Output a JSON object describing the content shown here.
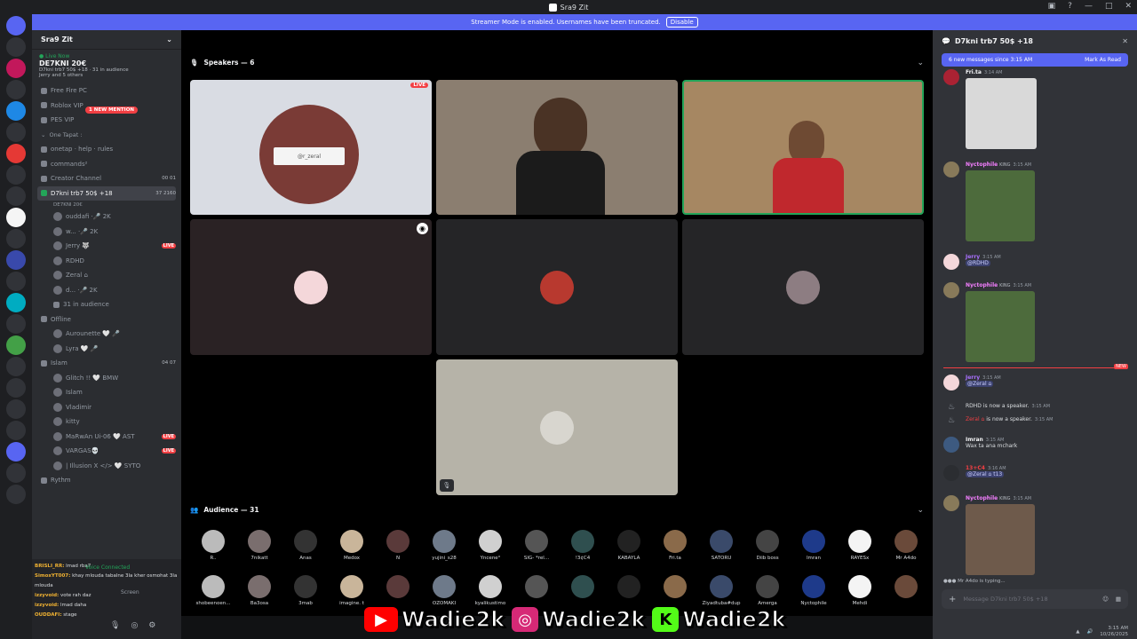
{
  "window": {
    "title": "Sra9 Zit"
  },
  "banner": {
    "text": "Streamer Mode is enabled. Usernames have been truncated.",
    "button": "Disable"
  },
  "sidebar": {
    "server_name": "Sra9 Zit",
    "live_label": "● Live Now",
    "live_title": "DE7KNI 20€",
    "live_sub": "D7kni trb7 50$ +18 · 31 in audience",
    "live_sub2": "Jerry and 5 others",
    "mention_badge": "1 NEW MENTION",
    "channels": [
      {
        "label": "Free Fire PC",
        "kind": "ch"
      },
      {
        "label": "Roblox VIP",
        "kind": "ch"
      },
      {
        "label": "PES VIP",
        "kind": "ch"
      },
      {
        "label": "One Tapat :",
        "kind": "cat"
      },
      {
        "label": "onetap · help · rules",
        "kind": "ch"
      },
      {
        "label": "commands²",
        "kind": "ch"
      },
      {
        "label": "Creator Channel",
        "kind": "ch",
        "count": "00 01"
      },
      {
        "label": "D7kni trb7 50$ +18",
        "kind": "active",
        "count": "37 2160"
      },
      {
        "label": "DE7KNI 20€",
        "kind": "sub"
      }
    ],
    "voice_users": [
      {
        "label": "ouddafi ·🎤 2K"
      },
      {
        "label": "w... ·🎤 2K"
      },
      {
        "label": "Jerry 🐺",
        "live": "LIVE"
      },
      {
        "label": "RDHD"
      },
      {
        "label": "Zeral ⌂"
      },
      {
        "label": "d... ·🎤 2K"
      },
      {
        "label": "31 in audience"
      }
    ],
    "offline_label": "Offline",
    "offline_users": [
      "Aurounette 🤍 🎤",
      "Lyra 🤍 🎤"
    ],
    "islam_label": "Islam",
    "islam_count": "04 07",
    "islam_users": [
      "Glitch !! 🤍 BMW",
      "Islam",
      "Vladimir",
      "kitty"
    ],
    "other_users": [
      {
        "label": "MaRwAn Ui-06 🤍 AST",
        "live": "LIVE"
      },
      {
        "label": "VARGAS💀",
        "live": "LIVE"
      },
      {
        "label": "| Illusion X </> 🤍 SYTO"
      }
    ],
    "rythm_label": "Rythm",
    "chat_lines": [
      {
        "name": "BRISLI_RR:",
        "text": "lmad rba7"
      },
      {
        "name": "SimoxYT007:",
        "text": "khay mlouda tabalne 3la kher osmohat 3la mlouda"
      },
      {
        "name": "izzyvoid:",
        "text": "vote rah daz"
      },
      {
        "name": "izzyvoid:",
        "text": "lmad daha"
      },
      {
        "name": "OUDDAFI:",
        "text": "stage"
      }
    ],
    "connected": "Voice Connected",
    "screen_label": "Screen"
  },
  "stage": {
    "speakers_label": "Speakers — 6",
    "audience_label": "Audience — 31",
    "live_badge": "LIVE",
    "overlay_handle": "@r_zeral",
    "audience_row1": [
      "R..",
      "7nikatt",
      "Anas",
      "Medox",
      "N",
      "yujini_s28",
      "Yncene°",
      "SIG- *rel...",
      "!3¢C4",
      "KABAYLA",
      "Fri.ta",
      "SATORU",
      "Diib boss",
      "Imran",
      "RAYESx",
      "Mr A4do"
    ],
    "audience_row2": [
      "shobeenoen...",
      "Ba3osa",
      "3mab",
      "imagine. t",
      "",
      "OZOMAKI",
      "kyalikustimo",
      "",
      "",
      "",
      "",
      "Ziyadtuba#dup",
      "Amerga",
      "Nyctophile",
      "Mehdi",
      ""
    ]
  },
  "chat": {
    "channel": "D7kni trb7 50$ +18",
    "new_messages": "6 new messages since 3:15 AM",
    "mark_read": "Mark As Read",
    "messages": [
      {
        "name": "Fri.ta",
        "time": "3:14 AM",
        "text": ""
      },
      {
        "name": "Nyctophile",
        "badge": "KING",
        "time": "3:15 AM",
        "text": ""
      },
      {
        "name": "Jerry",
        "time": "3:15 AM",
        "text": "@RDHD"
      },
      {
        "name": "Nyctophile",
        "badge": "KING",
        "time": "3:15 AM",
        "text": ""
      },
      {
        "name": "Jerry",
        "time": "3:15 AM",
        "text": "@Zeral ⌂"
      },
      {
        "name": "",
        "time": "3:15 AM",
        "text": "RDHD is now a speaker."
      },
      {
        "name": "Zeral ⌂",
        "time": "3:15 AM",
        "text": "is now a speaker."
      },
      {
        "name": "Imran",
        "time": "3:15 AM",
        "text": "Wax ta ana mchark"
      },
      {
        "name": "13+C4",
        "time": "3:16 AM",
        "text": "@Zeral ⌂  t13"
      },
      {
        "name": "Nyctophile",
        "badge": "KING",
        "time": "3:15 AM",
        "text": ""
      }
    ],
    "typing": "Mr A4do is typing...",
    "new_label": "NEW",
    "placeholder": "Message D7kni trb7 50$ +18"
  },
  "overlay": {
    "youtube": "Wadie2k",
    "instagram": "Wadie2k",
    "kick": "Wadie2k",
    "kick_letter": "K"
  },
  "taskbar": {
    "time": "3:15 AM",
    "date": "10/26/2025"
  },
  "colors": {
    "accent": "#5865f2",
    "live": "#f23f43",
    "online": "#23a559"
  }
}
